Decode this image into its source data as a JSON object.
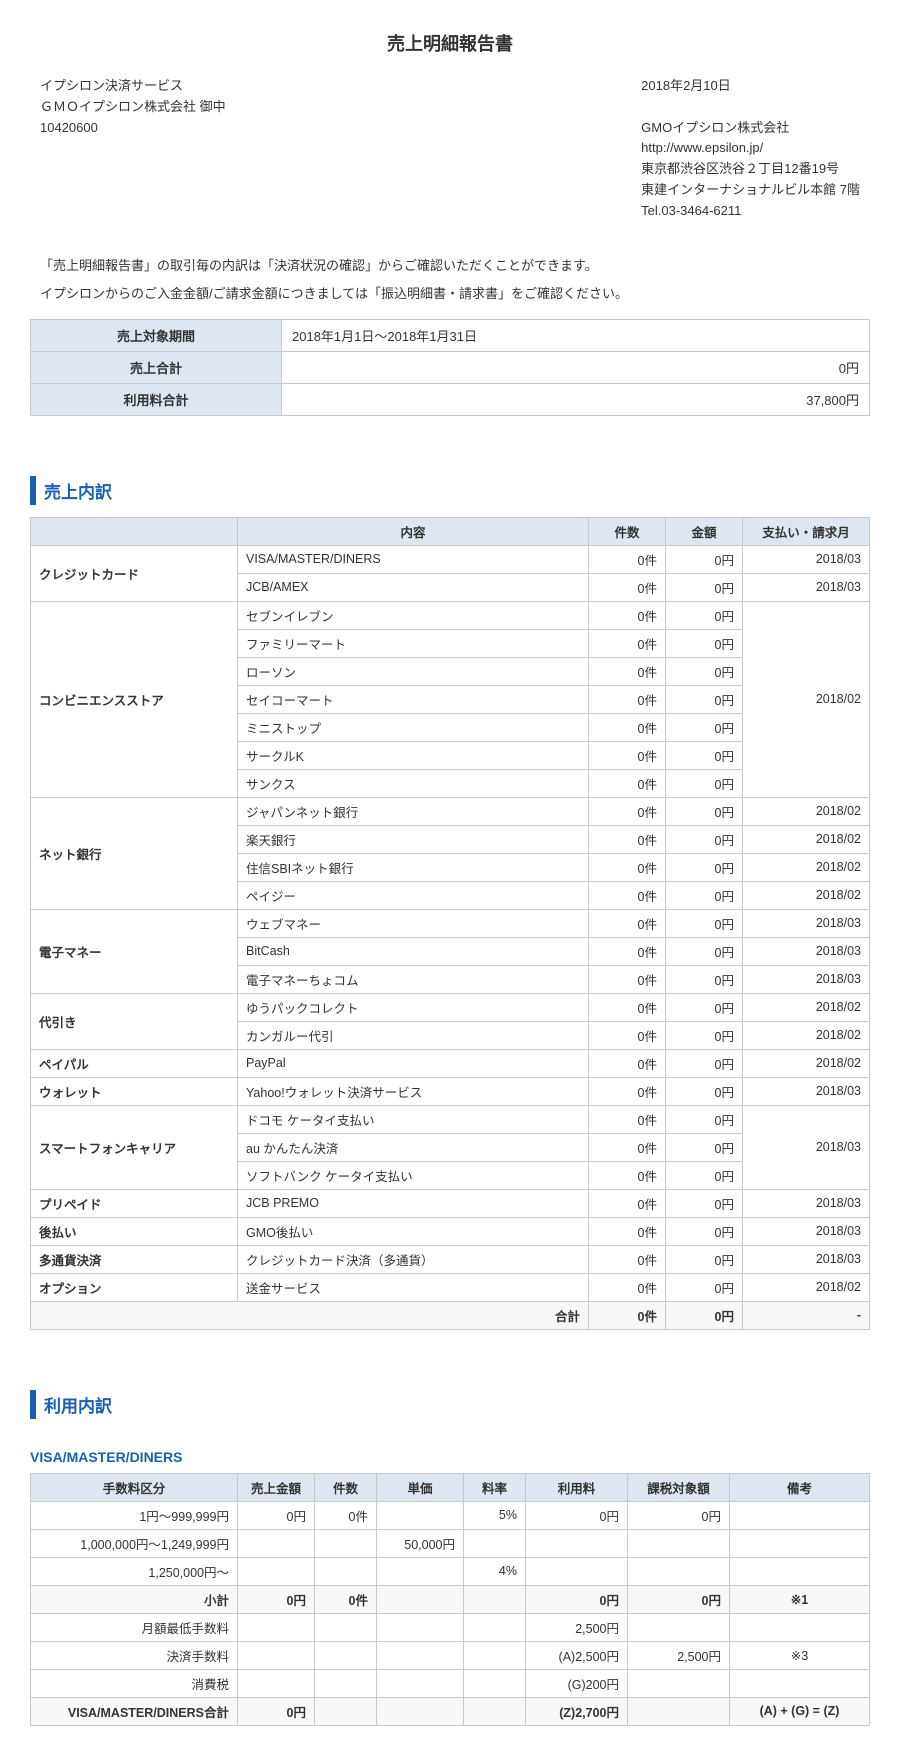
{
  "title": "売上明細報告書",
  "header": {
    "left": [
      "イプシロン決済サービス",
      "ＧＭＯイプシロン株式会社 御中",
      "10420600"
    ],
    "right": {
      "date": "2018年2月10日",
      "company": "GMOイプシロン株式会社",
      "url": "http://www.epsilon.jp/",
      "addr1": "東京都渋谷区渋谷２丁目12番19号",
      "addr2": "東建インターナショナルビル本館 7階",
      "tel": "Tel.03-3464-6211"
    }
  },
  "notes": [
    "「売上明細報告書」の取引毎の内訳は「決済状況の確認」からご確認いただくことができます。",
    "イプシロンからのご入金金額/ご請求金額につきましては「振込明細書・請求書」をご確認ください。"
  ],
  "summary": {
    "headers": {
      "period": "売上対象期間",
      "sales": "売上合計",
      "fee": "利用料合計"
    },
    "period": "2018年1月1日～2018年1月31日",
    "sales": "0円",
    "fee": "37,800円"
  },
  "sales_section": {
    "title": "売上内訳",
    "headers": {
      "content": "内容",
      "count": "件数",
      "amount": "金額",
      "month": "支払い・請求月"
    },
    "groups": [
      {
        "cat": "クレジットカード",
        "rows": [
          {
            "c": "VISA/MASTER/DINERS",
            "n": "0件",
            "a": "0円",
            "m": "2018/03"
          },
          {
            "c": "JCB/AMEX",
            "n": "0件",
            "a": "0円",
            "m": "2018/03"
          }
        ]
      },
      {
        "cat": "コンビニエンスストア",
        "month": "2018/02",
        "rows": [
          {
            "c": "セブンイレブン",
            "n": "0件",
            "a": "0円"
          },
          {
            "c": "ファミリーマート",
            "n": "0件",
            "a": "0円"
          },
          {
            "c": "ローソン",
            "n": "0件",
            "a": "0円"
          },
          {
            "c": "セイコーマート",
            "n": "0件",
            "a": "0円"
          },
          {
            "c": "ミニストップ",
            "n": "0件",
            "a": "0円"
          },
          {
            "c": "サークルK",
            "n": "0件",
            "a": "0円"
          },
          {
            "c": "サンクス",
            "n": "0件",
            "a": "0円"
          }
        ]
      },
      {
        "cat": "ネット銀行",
        "rows": [
          {
            "c": "ジャパンネット銀行",
            "n": "0件",
            "a": "0円",
            "m": "2018/02"
          },
          {
            "c": "楽天銀行",
            "n": "0件",
            "a": "0円",
            "m": "2018/02"
          },
          {
            "c": "住信SBIネット銀行",
            "n": "0件",
            "a": "0円",
            "m": "2018/02"
          },
          {
            "c": "ペイジー",
            "n": "0件",
            "a": "0円",
            "m": "2018/02"
          }
        ]
      },
      {
        "cat": "電子マネー",
        "rows": [
          {
            "c": "ウェブマネー",
            "n": "0件",
            "a": "0円",
            "m": "2018/03"
          },
          {
            "c": "BitCash",
            "n": "0件",
            "a": "0円",
            "m": "2018/03"
          },
          {
            "c": "電子マネーちょコム",
            "n": "0件",
            "a": "0円",
            "m": "2018/03"
          }
        ]
      },
      {
        "cat": "代引き",
        "rows": [
          {
            "c": "ゆうパックコレクト",
            "n": "0件",
            "a": "0円",
            "m": "2018/02"
          },
          {
            "c": "カンガルー代引",
            "n": "0件",
            "a": "0円",
            "m": "2018/02"
          }
        ]
      },
      {
        "cat": "ペイパル",
        "rows": [
          {
            "c": "PayPal",
            "n": "0件",
            "a": "0円",
            "m": "2018/02"
          }
        ]
      },
      {
        "cat": "ウォレット",
        "rows": [
          {
            "c": "Yahoo!ウォレット決済サービス",
            "n": "0件",
            "a": "0円",
            "m": "2018/03"
          }
        ]
      },
      {
        "cat": "スマートフォンキャリア",
        "month": "2018/03",
        "rows": [
          {
            "c": "ドコモ ケータイ支払い",
            "n": "0件",
            "a": "0円"
          },
          {
            "c": "au かんたん決済",
            "n": "0件",
            "a": "0円"
          },
          {
            "c": "ソフトバンク ケータイ支払い",
            "n": "0件",
            "a": "0円"
          }
        ]
      },
      {
        "cat": "プリペイド",
        "rows": [
          {
            "c": "JCB PREMO",
            "n": "0件",
            "a": "0円",
            "m": "2018/03"
          }
        ]
      },
      {
        "cat": "後払い",
        "rows": [
          {
            "c": "GMO後払い",
            "n": "0件",
            "a": "0円",
            "m": "2018/03"
          }
        ]
      },
      {
        "cat": "多通貨決済",
        "rows": [
          {
            "c": "クレジットカード決済（多通貨）",
            "n": "0件",
            "a": "0円",
            "m": "2018/03"
          }
        ]
      },
      {
        "cat": "オプション",
        "rows": [
          {
            "c": "送金サービス",
            "n": "0件",
            "a": "0円",
            "m": "2018/02"
          }
        ]
      }
    ],
    "total": {
      "label": "合計",
      "n": "0件",
      "a": "0円",
      "m": "-"
    }
  },
  "usage_section": {
    "title": "利用内訳",
    "sub": "VISA/MASTER/DINERS",
    "headers": {
      "col1": "手数料区分",
      "col2": "売上金額",
      "col3": "件数",
      "col4": "単価",
      "col5": "料率",
      "col6": "利用料",
      "col7": "課税対象額",
      "col8": "備考"
    },
    "rows": [
      {
        "c1": "1円～999,999円",
        "c2": "0円",
        "c3": "0件",
        "c4": "",
        "c5": "5%",
        "c6": "0円",
        "c7": "0円",
        "c8": ""
      },
      {
        "c1": "1,000,000円～1,249,999円",
        "c2": "",
        "c3": "",
        "c4": "50,000円",
        "c5": "",
        "c6": "",
        "c7": "",
        "c8": ""
      },
      {
        "c1": "1,250,000円～",
        "c2": "",
        "c3": "",
        "c4": "",
        "c5": "4%",
        "c6": "",
        "c7": "",
        "c8": ""
      }
    ],
    "subtotal": {
      "c1": "小計",
      "c2": "0円",
      "c3": "0件",
      "c4": "",
      "c5": "",
      "c6": "0円",
      "c7": "0円",
      "c8": "※1"
    },
    "extras": [
      {
        "c1": "月額最低手数料",
        "c6": "2,500円"
      },
      {
        "c1": "決済手数料",
        "c6": "(A)2,500円",
        "c7": "2,500円",
        "c8": "※3"
      },
      {
        "c1": "消費税",
        "c6": "(G)200円"
      }
    ],
    "grand": {
      "c1": "VISA/MASTER/DINERS合計",
      "c2": "0円",
      "c6": "(Z)2,700円",
      "c8": "(A) + (G) = (Z)"
    }
  }
}
